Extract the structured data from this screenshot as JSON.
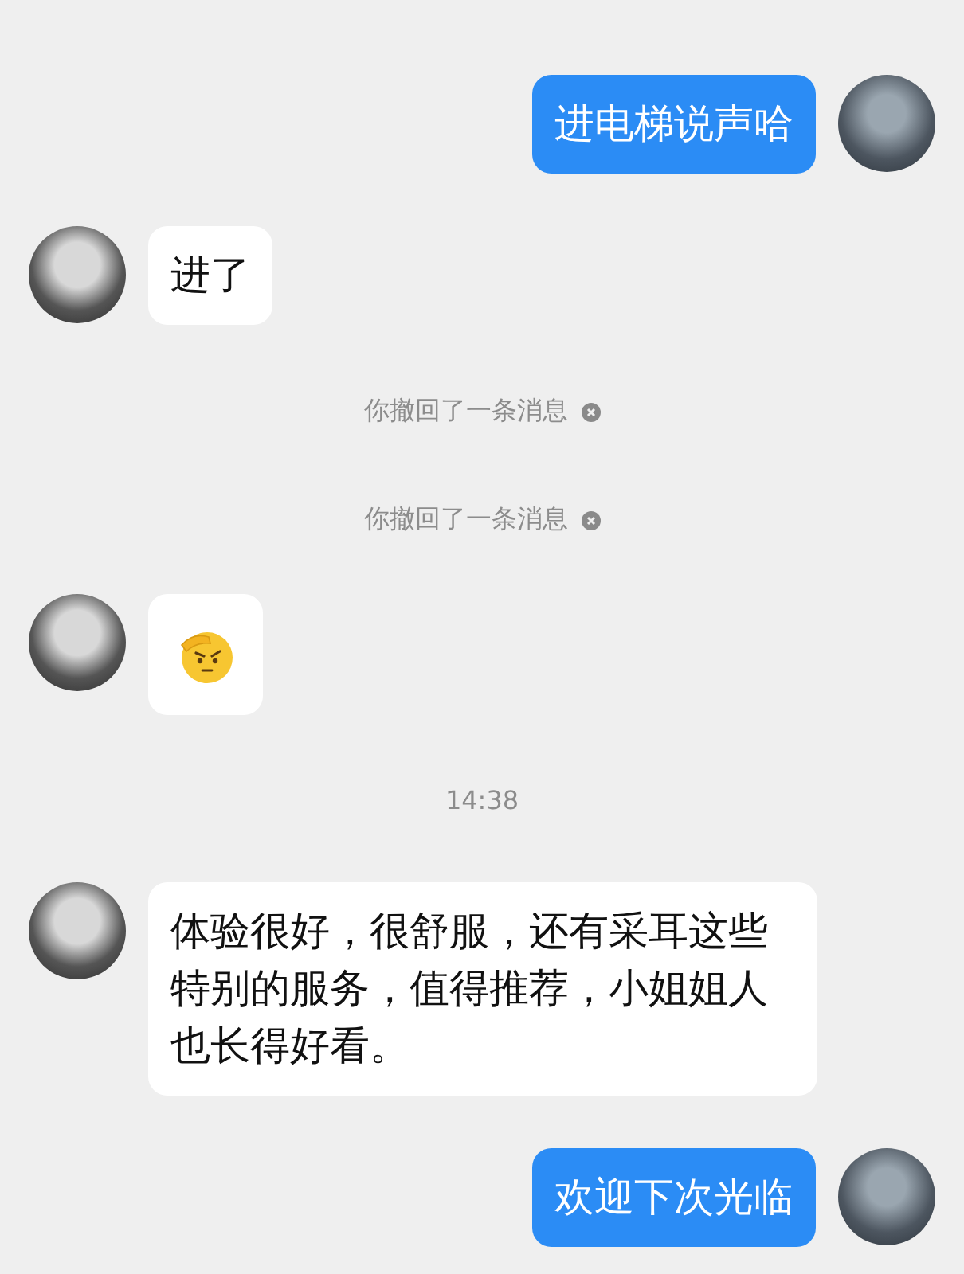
{
  "messages": [
    {
      "kind": "text",
      "sent": true,
      "text": "进电梯说声哈"
    },
    {
      "kind": "text",
      "sent": false,
      "text": "进了"
    },
    {
      "kind": "recall",
      "text": "你撤回了一条消息"
    },
    {
      "kind": "recall",
      "text": "你撤回了一条消息"
    },
    {
      "kind": "emoji",
      "sent": false
    },
    {
      "kind": "time",
      "text": "14:38"
    },
    {
      "kind": "text",
      "sent": false,
      "text": "体验很好，很舒服，还有采耳这些特别的服务，值得推荐，小姐姐人也长得好看。"
    },
    {
      "kind": "text",
      "sent": true,
      "text": "欢迎下次光临"
    }
  ]
}
